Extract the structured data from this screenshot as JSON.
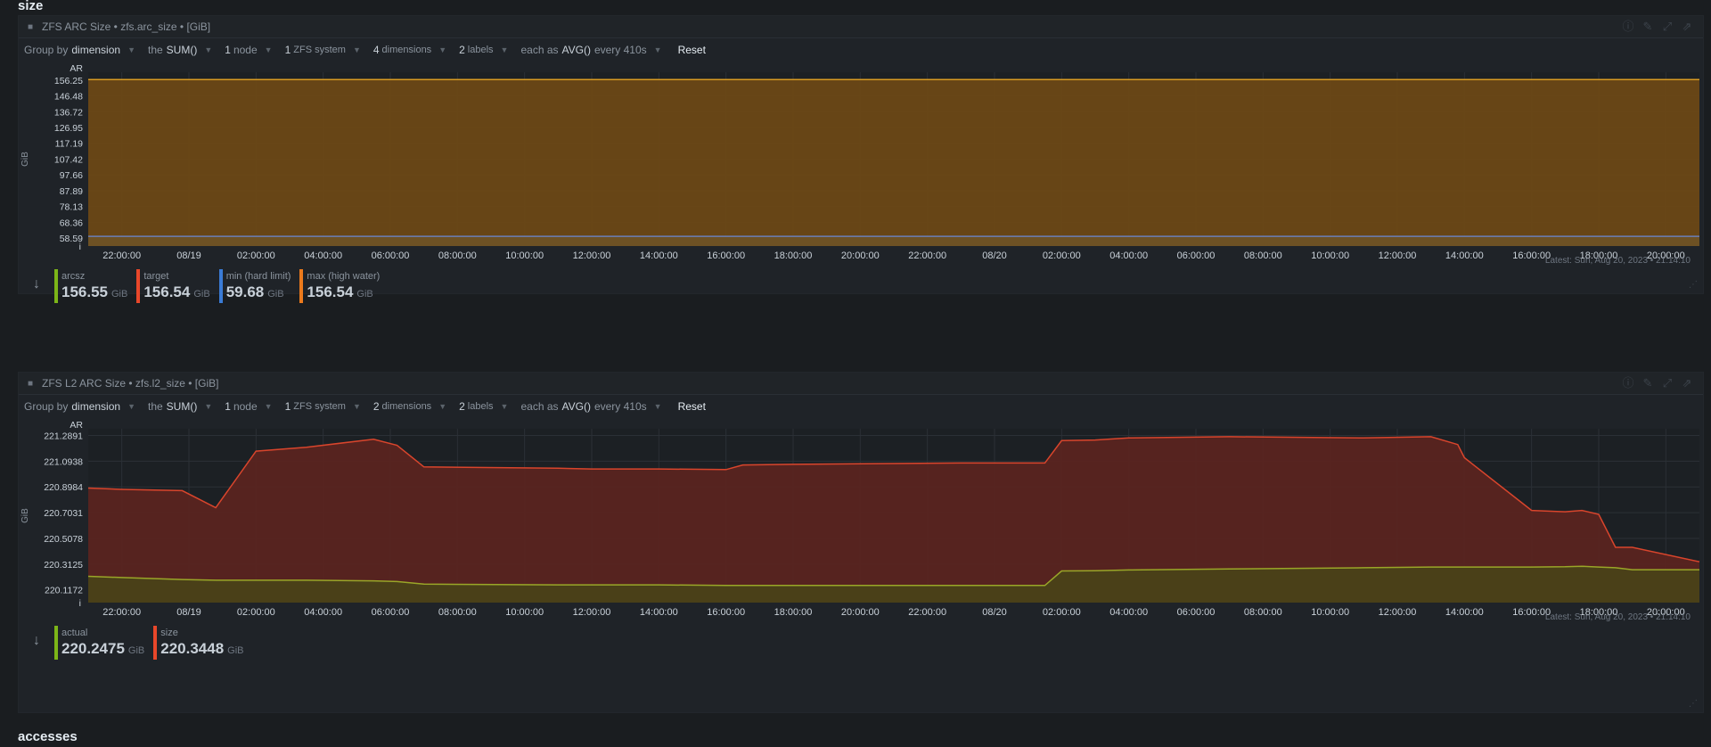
{
  "sections": {
    "top": "size",
    "bottom": "accesses"
  },
  "toolbar_common": {
    "group_by_prefix": "Group by",
    "group_by_value": "dimension",
    "agg_prefix": "the",
    "agg_value": "SUM()",
    "nodes_count": "1",
    "nodes_label": "node",
    "systems_count": "1",
    "systems_label": "ZFS system",
    "labels_count": "2",
    "labels_label": "labels",
    "each_as_prefix": "each as",
    "each_as_value": "AVG()",
    "every_label": "every 410s",
    "reset_label": "Reset"
  },
  "charts": [
    {
      "title": "ZFS ARC Size • zfs.arc_size • [GiB]",
      "dimensions_count": "4",
      "dimensions_label": "dimensions",
      "y_unit": "GiB",
      "y_top_label": "AR",
      "y_bottom_label": "i",
      "y_ticks": [
        "156.25",
        "146.48",
        "136.72",
        "126.95",
        "117.19",
        "107.42",
        "97.66",
        "87.89",
        "78.13",
        "68.36",
        "58.59"
      ],
      "latest": "Latest: Sun, Aug 20, 2023 • 21:14:10",
      "legend": [
        {
          "name": "arcsz",
          "value": "156.55",
          "unit": "GiB",
          "color": "#7cb518"
        },
        {
          "name": "target",
          "value": "156.54",
          "unit": "GiB",
          "color": "#e8472a"
        },
        {
          "name": "min (hard limit)",
          "value": "59.68",
          "unit": "GiB",
          "color": "#3a7bd5"
        },
        {
          "name": "max (high water)",
          "value": "156.54",
          "unit": "GiB",
          "color": "#ec7a1c"
        }
      ]
    },
    {
      "title": "ZFS L2 ARC Size • zfs.l2_size • [GiB]",
      "dimensions_count": "2",
      "dimensions_label": "dimensions",
      "y_unit": "GiB",
      "y_top_label": "AR",
      "y_bottom_label": "i",
      "y_ticks": [
        "221.2891",
        "221.0938",
        "220.8984",
        "220.7031",
        "220.5078",
        "220.3125",
        "220.1172"
      ],
      "latest": "Latest: Sun, Aug 20, 2023 • 21:14:10",
      "legend": [
        {
          "name": "actual",
          "value": "220.2475",
          "unit": "GiB",
          "color": "#7cb518"
        },
        {
          "name": "size",
          "value": "220.3448",
          "unit": "GiB",
          "color": "#e8472a"
        }
      ]
    }
  ],
  "x_ticks": [
    "22:00:00",
    "08/19",
    "02:00:00",
    "04:00:00",
    "06:00:00",
    "08:00:00",
    "10:00:00",
    "12:00:00",
    "14:00:00",
    "16:00:00",
    "18:00:00",
    "20:00:00",
    "22:00:00",
    "08/20",
    "02:00:00",
    "04:00:00",
    "06:00:00",
    "08:00:00",
    "10:00:00",
    "12:00:00",
    "14:00:00",
    "16:00:00",
    "18:00:00",
    "20:00:00"
  ],
  "chart_data": [
    {
      "type": "area",
      "title": "ZFS ARC Size • zfs.arc_size • [GiB]",
      "ylabel": "GiB",
      "ylim": [
        53.7,
        161.1
      ],
      "series": [
        {
          "name": "max (high water)",
          "values": [
            156.54,
            156.54
          ]
        },
        {
          "name": "min (hard limit)",
          "values": [
            59.68,
            59.68
          ]
        }
      ]
    },
    {
      "type": "area",
      "title": "ZFS L2 ARC Size • zfs.l2_size • [GiB]",
      "ylabel": "GiB",
      "ylim": [
        220.02,
        221.34
      ],
      "x_hours": [
        0,
        1.0,
        2.8,
        3.8,
        5.0,
        6.5,
        8.5,
        9.2,
        10.0,
        14.0,
        15.0,
        17.0,
        19.0,
        19.5,
        21.0,
        26.0,
        28.5,
        29.0,
        30.0,
        31.0,
        34.0,
        38.0,
        40.0,
        40.8,
        41.0,
        43.0,
        44.0,
        44.5,
        45.0,
        45.5,
        46.0,
        48.0
      ],
      "series": [
        {
          "name": "size",
          "values": [
            220.89,
            220.88,
            220.87,
            220.74,
            221.17,
            221.2,
            221.26,
            221.215,
            221.05,
            221.04,
            221.035,
            221.035,
            221.03,
            221.065,
            221.07,
            221.08,
            221.08,
            221.25,
            221.255,
            221.27,
            221.28,
            221.27,
            221.28,
            221.22,
            221.12,
            220.72,
            220.71,
            220.72,
            220.69,
            220.44,
            220.44,
            220.33
          ]
        },
        {
          "name": "actual",
          "values": [
            220.22,
            220.21,
            220.195,
            220.19,
            220.19,
            220.19,
            220.185,
            220.18,
            220.16,
            220.155,
            220.155,
            220.155,
            220.15,
            220.15,
            220.15,
            220.15,
            220.15,
            220.26,
            220.262,
            220.268,
            220.275,
            220.285,
            220.29,
            220.29,
            220.29,
            220.29,
            220.292,
            220.296,
            220.29,
            220.285,
            220.27,
            220.27
          ]
        }
      ]
    }
  ]
}
